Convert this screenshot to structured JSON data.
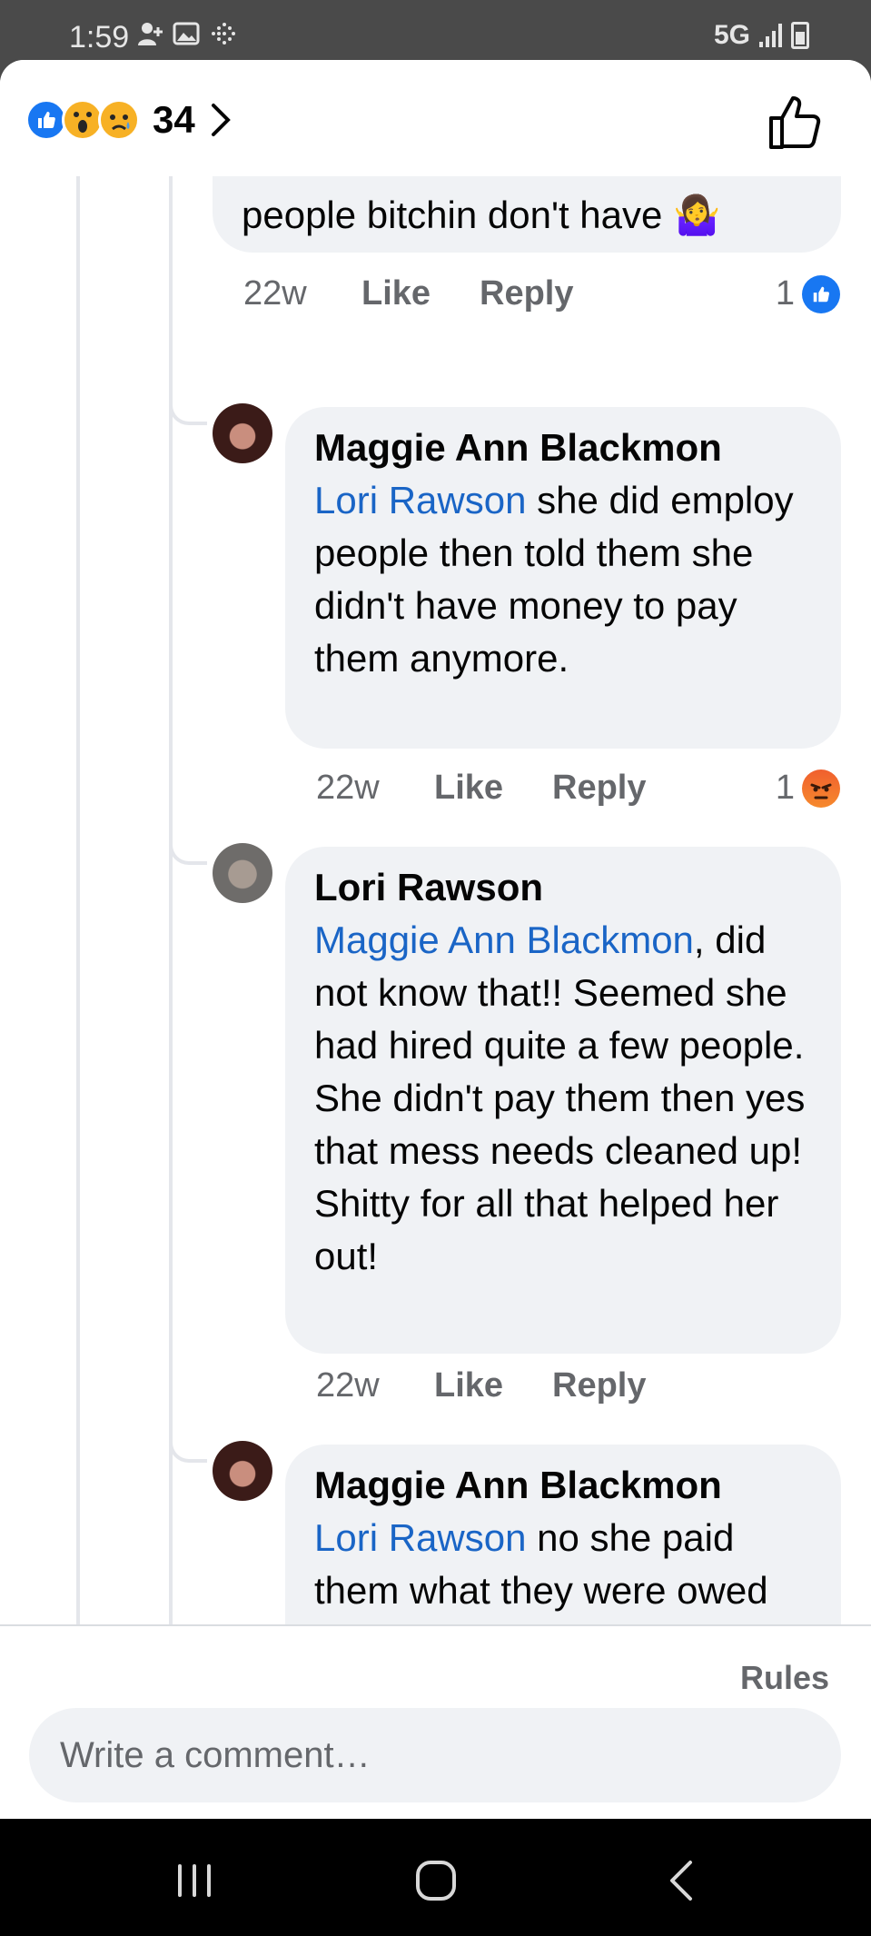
{
  "status_bar": {
    "time": "1:59",
    "network": "5G",
    "icons": [
      "person-add-icon",
      "image-icon",
      "dots-grid-icon",
      "signal-icon",
      "battery-icon"
    ]
  },
  "header": {
    "reactions": [
      "like",
      "wow",
      "sad"
    ],
    "reaction_count": "34"
  },
  "comments": [
    {
      "text": "people bitchin don't have",
      "emoji": "🤷‍♀️",
      "time": "22w",
      "like_label": "Like",
      "reply_label": "Reply",
      "reaction_count": "1",
      "reaction_type": "like"
    },
    {
      "author": "Maggie Ann Blackmon",
      "mention": "Lori Rawson",
      "text": " she did employ people then told them she didn't have money to pay them anymore.",
      "time": "22w",
      "like_label": "Like",
      "reply_label": "Reply",
      "reaction_count": "1",
      "reaction_type": "angry"
    },
    {
      "author": "Lori Rawson",
      "mention": "Maggie Ann Blackmon",
      "text": ", did not know that!! Seemed she had hired quite a few people. She didn't pay them then yes that mess needs cleaned up! Shitty for all that helped her out!",
      "time": "22w",
      "like_label": "Like",
      "reply_label": "Reply"
    },
    {
      "author": "Maggie Ann Blackmon",
      "mention": "Lori Rawson",
      "text": " no she paid them what they were owed but told them that"
    }
  ],
  "footer": {
    "rules_label": "Rules",
    "comment_placeholder": "Write a comment…"
  },
  "colors": {
    "link_blue": "#1a65c6",
    "like_blue": "#1877f2",
    "bubble_bg": "#f0f2f5",
    "meta_gray": "#65676b"
  }
}
